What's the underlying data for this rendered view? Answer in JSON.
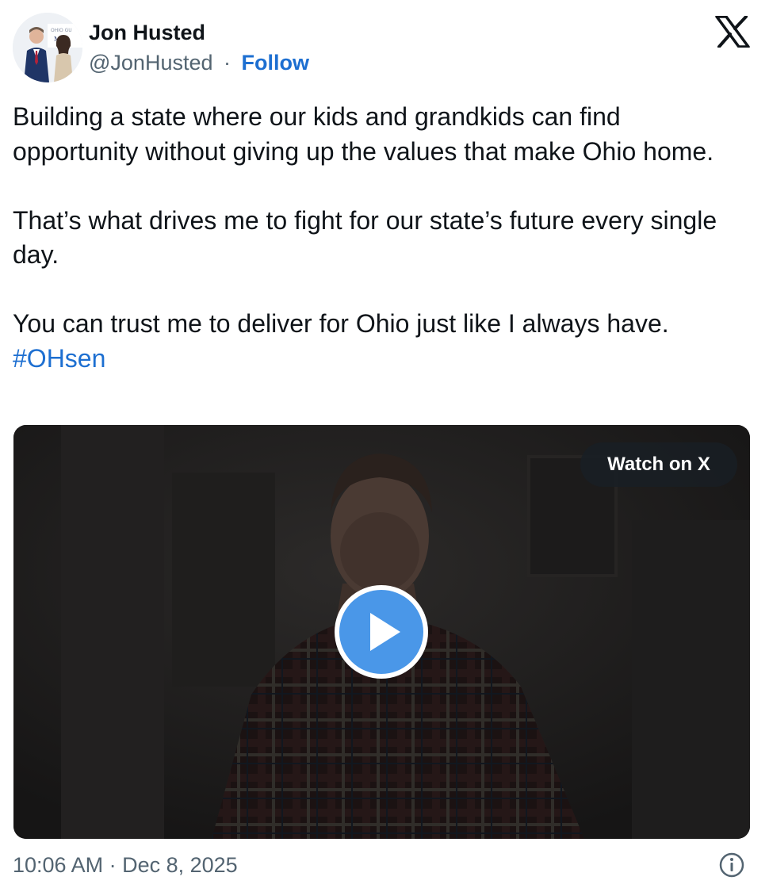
{
  "author": {
    "name": "Jon Husted",
    "handle": "@JonHusted",
    "separator": "·",
    "follow_label": "Follow",
    "avatar_sign_text": "OHIO GU"
  },
  "tweet": {
    "paragraph_1": "Building a state where our kids and grandkids can find opportunity without giving up the values that make Ohio home.",
    "paragraph_2": "That’s what drives me to fight for our state’s future every single day.",
    "paragraph_3": "You can trust me to deliver for Ohio just like I always have.",
    "hashtag": "#OHsen"
  },
  "video": {
    "watch_label": "Watch on X",
    "play_icon": "play-icon"
  },
  "footer": {
    "timestamp": "10:06 AM · Dec 8, 2025",
    "info_icon": "info-icon"
  },
  "icons": {
    "brand": "x-logo-icon"
  },
  "colors": {
    "text": "#0f1419",
    "secondary": "#536471",
    "link": "#1d6fd1",
    "play_button": "#4a97e8",
    "video_bg": "#1b1a1a"
  }
}
